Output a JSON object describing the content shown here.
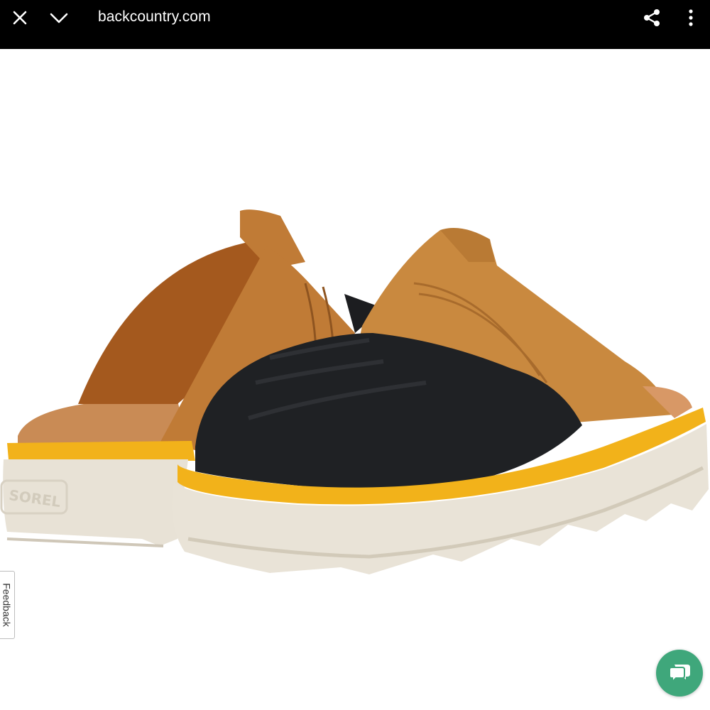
{
  "topbar": {
    "url": "backcountry.com",
    "close_icon": "close-icon",
    "collapse_icon": "chevron-down-icon",
    "share_icon": "share-icon",
    "more_icon": "more-vertical-icon",
    "background": "#000000"
  },
  "product": {
    "brand_mark": "SOREL",
    "image_icon": "product-photo"
  },
  "feedback": {
    "label": "Feedback"
  },
  "chat": {
    "icon": "chat-icon",
    "color": "#3fa77b"
  }
}
